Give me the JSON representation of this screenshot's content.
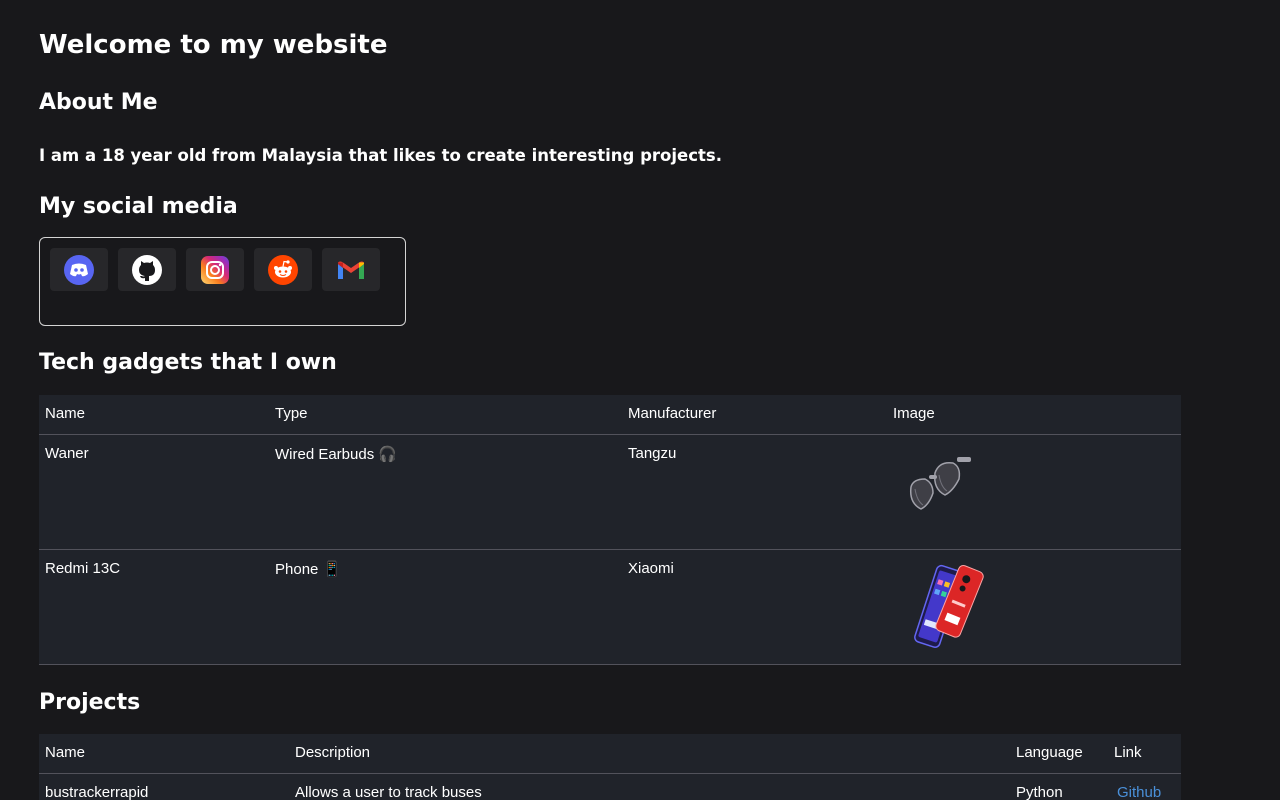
{
  "page": {
    "title": "Welcome to my website"
  },
  "about": {
    "heading": "About Me",
    "text": "I am a 18 year old from Malaysia that likes to create interesting projects."
  },
  "social": {
    "heading": "My social media",
    "items": [
      {
        "name": "discord",
        "icon": "discord-icon",
        "color": "#5865f2"
      },
      {
        "name": "github",
        "icon": "github-icon",
        "color": "#ffffff"
      },
      {
        "name": "instagram",
        "icon": "instagram-icon",
        "color": "#e1306c"
      },
      {
        "name": "reddit",
        "icon": "reddit-icon",
        "color": "#ff4500"
      },
      {
        "name": "gmail",
        "icon": "gmail-icon",
        "color": "#ea4335"
      }
    ]
  },
  "gadgets": {
    "heading": "Tech gadgets that I own",
    "columns": [
      "Name",
      "Type",
      "Manufacturer",
      "Image"
    ],
    "rows": [
      {
        "name": "Waner",
        "type": "Wired Earbuds 🎧",
        "manufacturer": "Tangzu",
        "image_icon": "earbuds-image"
      },
      {
        "name": "Redmi 13C",
        "type": "Phone 📱",
        "manufacturer": "Xiaomi",
        "image_icon": "phone-image"
      }
    ]
  },
  "projects": {
    "heading": "Projects",
    "columns": [
      "Name",
      "Description",
      "Language",
      "Link"
    ],
    "rows": [
      {
        "name": "bustrackerrapid",
        "description": "Allows a user to track buses",
        "language": "Python",
        "link": "Github"
      }
    ]
  },
  "colors": {
    "background": "#18181b",
    "table_bg": "#20232a",
    "link": "#4a90d9"
  }
}
